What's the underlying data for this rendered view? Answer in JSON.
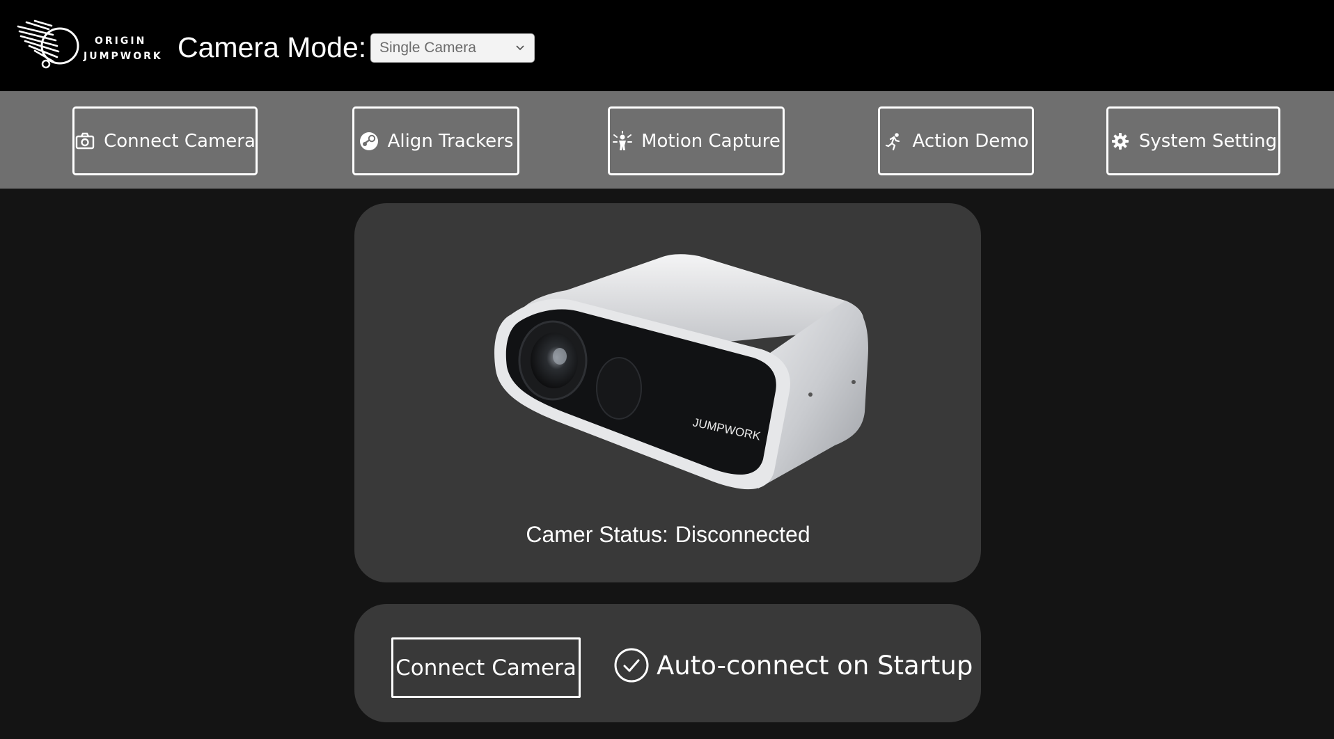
{
  "header": {
    "logo_line1": "ORIGIN",
    "logo_line2": "JUMPWORK",
    "camera_mode_label": "Camera Mode:",
    "camera_mode_value": "Single Camera"
  },
  "nav": {
    "items": [
      {
        "label": "Connect Camera",
        "icon": "camera-icon"
      },
      {
        "label": "Align Trackers",
        "icon": "steam-icon"
      },
      {
        "label": "Motion Capture",
        "icon": "person-burst-icon"
      },
      {
        "label": "Action Demo",
        "icon": "running-icon"
      },
      {
        "label": "System Setting",
        "icon": "gear-icon"
      }
    ]
  },
  "camera_panel": {
    "device_brand": "JUMPWORK",
    "status_label": "Camer Status:",
    "status_value": "Disconnected"
  },
  "actions": {
    "connect_button": "Connect Camera",
    "auto_connect_label": "Auto-connect on Startup",
    "auto_connect_checked": true
  },
  "colors": {
    "header_bg": "#000000",
    "nav_bg": "#6f6f6f",
    "page_bg": "#141414",
    "panel_bg": "#393939"
  }
}
